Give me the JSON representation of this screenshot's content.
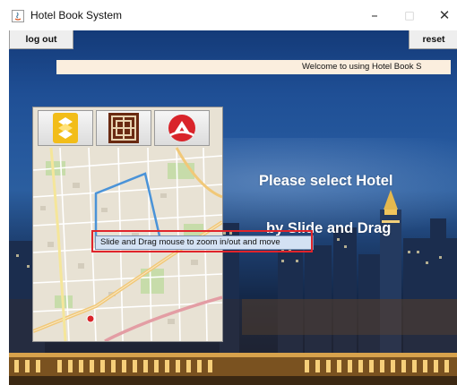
{
  "window": {
    "title": "Hotel Book System",
    "controls": {
      "minimize": "–",
      "maximize": "□",
      "close": "✕"
    }
  },
  "toolbar": {
    "logout_label": "log out",
    "reset_label": "reset"
  },
  "welcome": {
    "text": "Welcome to using Hotel Book S"
  },
  "main": {
    "heading_line1": "Please select Hotel",
    "heading_line2": "by Slide and Drag"
  },
  "map": {
    "buttons": [
      {
        "icon": "hotel-icon",
        "color": "#f2bd19"
      },
      {
        "icon": "building-icon",
        "color": "#6a2a12"
      },
      {
        "icon": "location-icon",
        "color": "#d9242a"
      }
    ],
    "tooltip": "Slide and Drag mouse to zoom in/out and move"
  },
  "colors": {
    "welcome_bg": "#fbeede",
    "highlight": "#e0242b",
    "route": "#4a93d8"
  }
}
